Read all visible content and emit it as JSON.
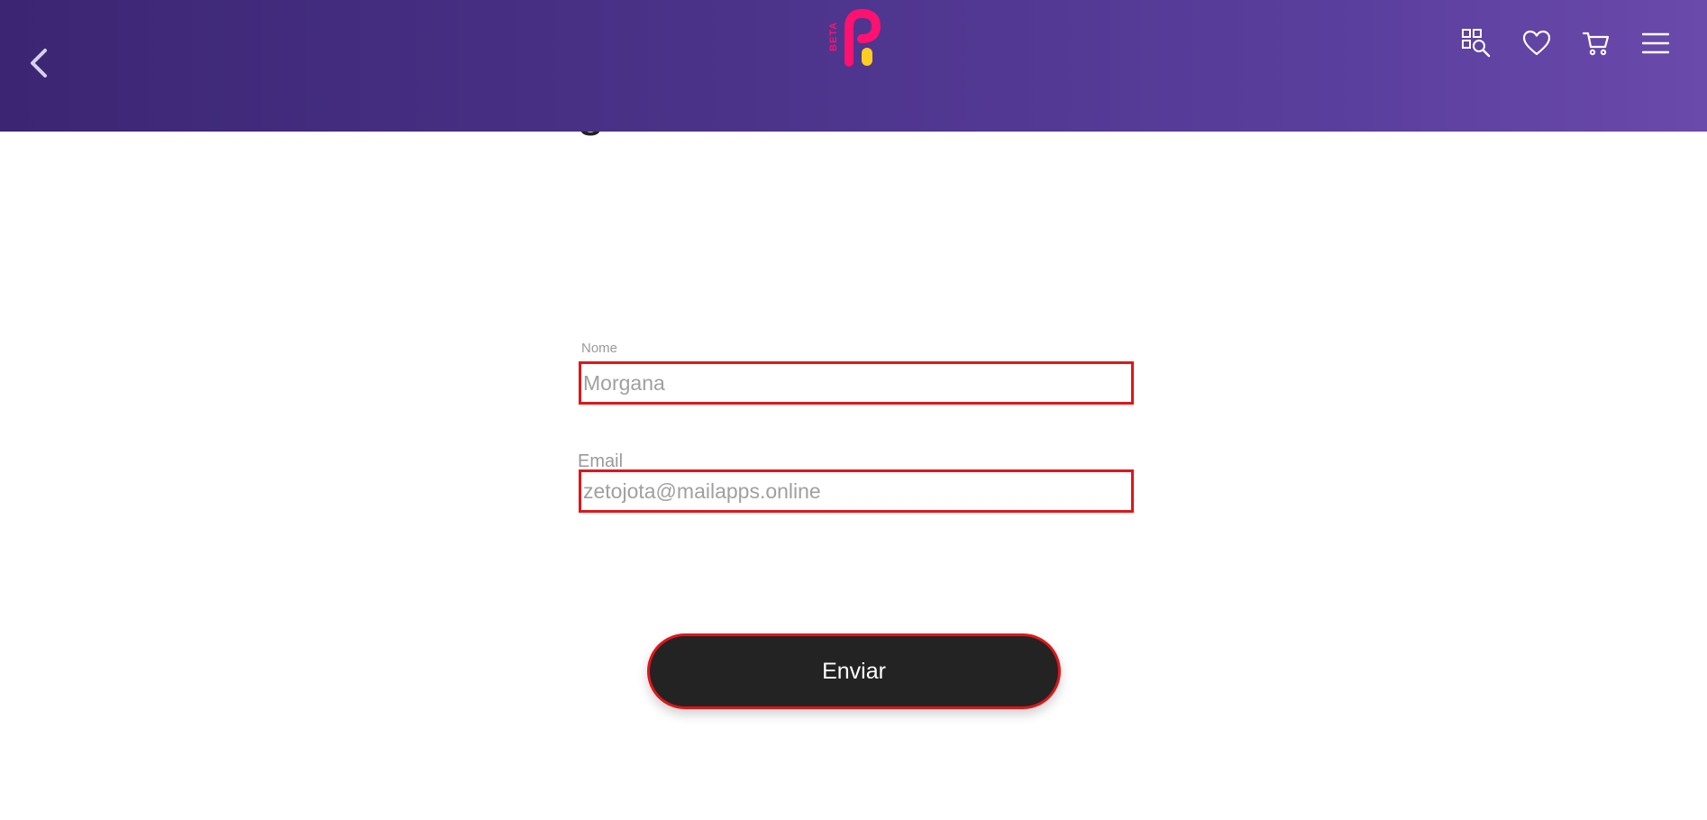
{
  "header": {
    "back_icon": "chevron-left-icon",
    "logo": {
      "badge_text": "BETA",
      "brand_color": "#ff1170",
      "accent_color": "#ffcc22"
    },
    "actions": [
      {
        "name": "grid-search-icon"
      },
      {
        "name": "heart-icon"
      },
      {
        "name": "cart-icon"
      },
      {
        "name": "hamburger-menu-icon"
      }
    ],
    "gradient_colors": [
      "#3c2673",
      "#6a4aab"
    ]
  },
  "page": {
    "heading_fragment": "g"
  },
  "form": {
    "name_label": "Nome",
    "name_value": "Morgana",
    "email_label": "Email",
    "email_value": "zetojota@mailapps.online",
    "submit_label": "Enviar",
    "error_border_color": "#e0161a"
  }
}
